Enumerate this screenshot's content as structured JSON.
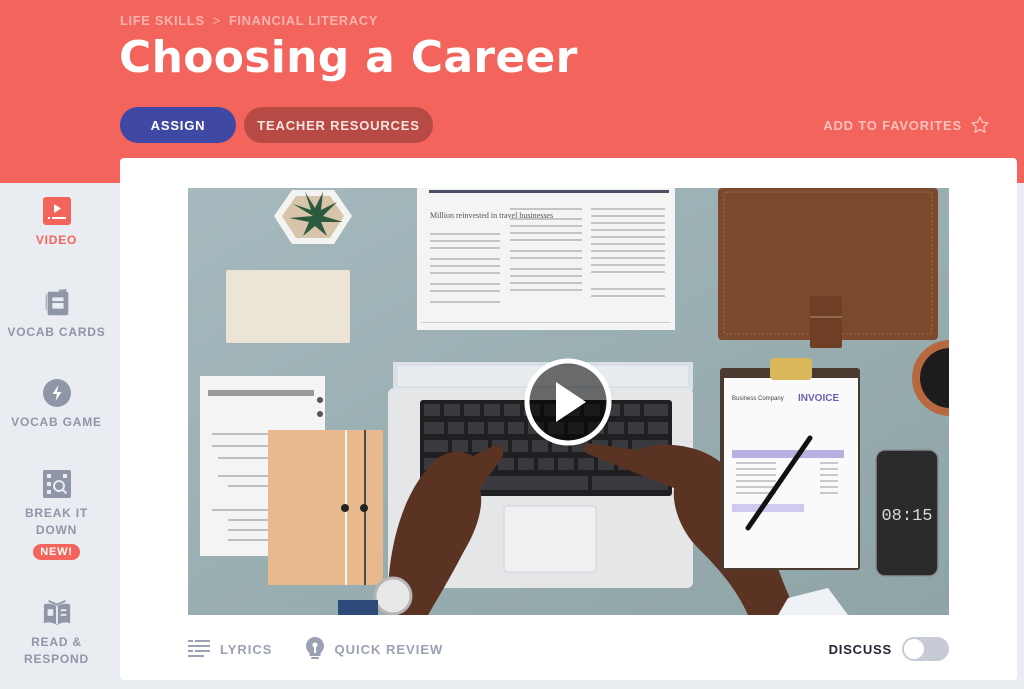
{
  "header": {
    "breadcrumb": [
      "LIFE SKILLS",
      "FINANCIAL LITERACY"
    ],
    "breadcrumb_separator": ">",
    "title": "Choosing a Career",
    "assign_label": "ASSIGN",
    "resources_label": "TEACHER RESOURCES",
    "favorites_label": "ADD TO FAVORITES"
  },
  "sidebar": {
    "items": [
      {
        "label": "VIDEO",
        "icon": "video-icon",
        "active": true
      },
      {
        "label": "VOCAB CARDS",
        "icon": "cards-icon",
        "active": false
      },
      {
        "label": "VOCAB GAME",
        "icon": "lightning-icon",
        "active": false
      },
      {
        "label": "BREAK IT DOWN",
        "icon": "magnifier-grid-icon",
        "active": false,
        "badge": "NEW!"
      },
      {
        "label": "READ & RESPOND",
        "icon": "open-book-icon",
        "active": false
      }
    ]
  },
  "video": {
    "thumbnail_description": "Overhead view of hands typing on a laptop on a desk with documents, plant, folder, clipboard invoice and phone",
    "phone_clock": "08:15",
    "newspaper_headline": "Million reinvested in travel businesses",
    "invoice_title": "INVOICE",
    "invoice_company": "Business Company"
  },
  "controls": {
    "lyrics_label": "LYRICS",
    "quick_review_label": "QUICK REVIEW",
    "discuss_label": "DISCUSS",
    "discuss_on": false
  },
  "colors": {
    "brand_red": "#f2645c",
    "assign_blue": "#3f48a5",
    "resources_dark_red": "#b84a45",
    "sidebar_bg": "#e9edf1",
    "muted_icon": "#8f96a8"
  }
}
